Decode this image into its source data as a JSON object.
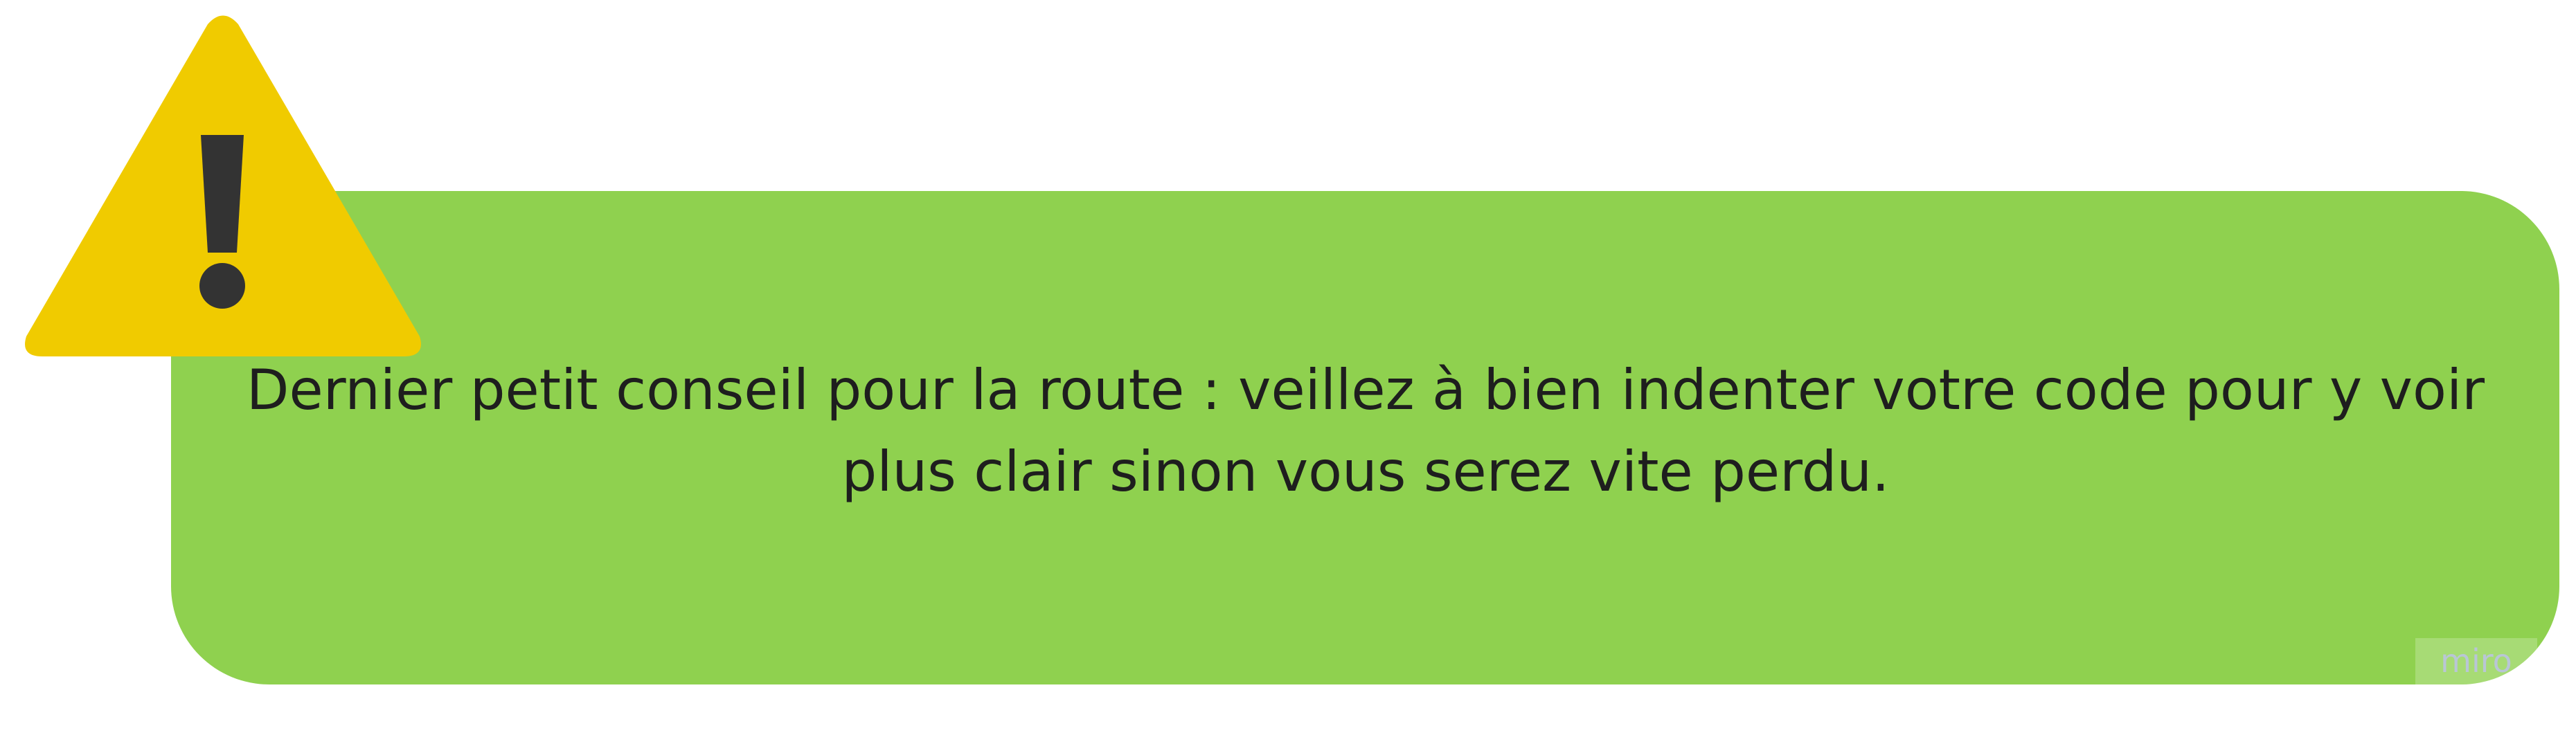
{
  "diagram": {
    "message": "Dernier petit conseil pour la route : veillez à bien indenter votre code pour y voir plus clair sinon vous serez vite perdu.",
    "icon": "warning-icon",
    "watermark": "miro"
  },
  "colors": {
    "card": "#8fd14f",
    "triangle": "#f0cb00",
    "exclamation": "#333333",
    "text": "#1e1e1e"
  }
}
